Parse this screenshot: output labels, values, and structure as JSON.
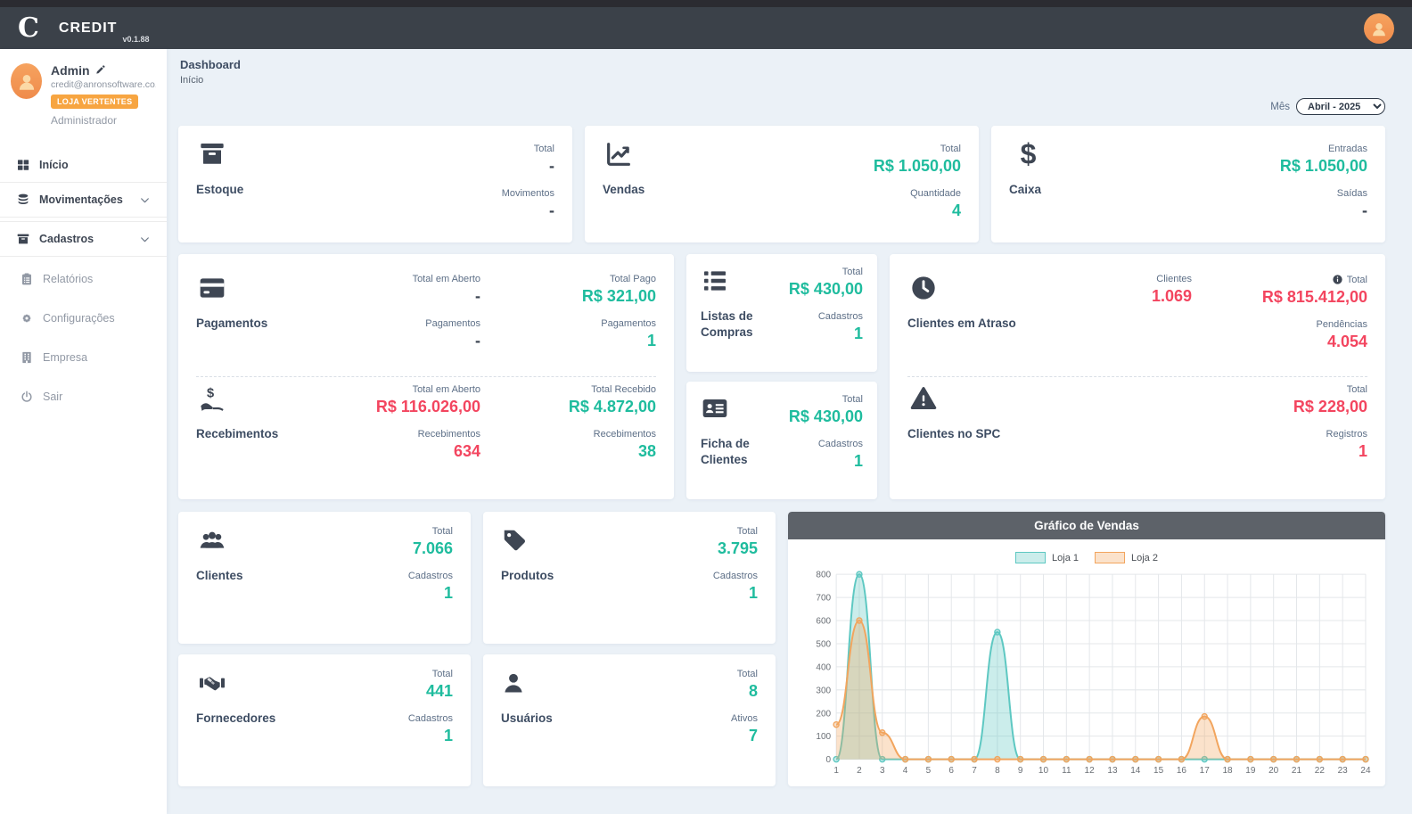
{
  "colors": {
    "accent_teal": "#1fbc9e",
    "accent_red": "#f3455f",
    "accent_orange": "#f7a541",
    "navbar": "#3b4149",
    "chart_header": "#5d6269"
  },
  "navbar": {
    "logo_letter": "C",
    "app_name": "CREDIT",
    "version": "v0.1.88"
  },
  "sidebar": {
    "user": {
      "name": "Admin",
      "email": "credit@anronsoftware.co...",
      "badge": "LOJA VERTENTES",
      "role": "Administrador"
    },
    "items": [
      {
        "label": "Início",
        "icon": "grid-icon"
      },
      {
        "label": "Movimentações",
        "icon": "database-icon",
        "expandable": true
      },
      {
        "label": "Cadastros",
        "icon": "archive-icon",
        "expandable": true
      },
      {
        "label": "Relatórios",
        "icon": "clipboard-icon"
      },
      {
        "label": "Configurações",
        "icon": "gear-icon"
      },
      {
        "label": "Empresa",
        "icon": "building-icon"
      },
      {
        "label": "Sair",
        "icon": "power-icon"
      }
    ]
  },
  "header": {
    "title": "Dashboard",
    "breadcrumb": "Início",
    "month_label": "Mês",
    "month_value": "Abril - 2025"
  },
  "summary_cards": [
    {
      "title": "Estoque",
      "icon": "box-icon",
      "stats": [
        {
          "label": "Total",
          "value": "-",
          "tone": "dark"
        },
        {
          "label": "Movimentos",
          "value": "-",
          "tone": "dark"
        }
      ]
    },
    {
      "title": "Vendas",
      "icon": "chart-line-icon",
      "stats": [
        {
          "label": "Total",
          "value": "R$ 1.050,00",
          "tone": "teal"
        },
        {
          "label": "Quantidade",
          "value": "4",
          "tone": "teal"
        }
      ]
    },
    {
      "title": "Caixa",
      "icon": "dollar-icon",
      "stats": [
        {
          "label": "Entradas",
          "value": "R$ 1.050,00",
          "tone": "teal"
        },
        {
          "label": "Saídas",
          "value": "-",
          "tone": "dark"
        }
      ]
    }
  ],
  "finance_card": {
    "pagamentos": {
      "title": "Pagamentos",
      "icon": "credit-card-icon",
      "open": {
        "label": "Total em Aberto",
        "value": "-",
        "tone": "dark"
      },
      "open_count": {
        "label": "Pagamentos",
        "value": "-",
        "tone": "dark"
      },
      "paid": {
        "label": "Total Pago",
        "value": "R$ 321,00",
        "tone": "teal"
      },
      "paid_count": {
        "label": "Pagamentos",
        "value": "1",
        "tone": "teal"
      }
    },
    "recebimentos": {
      "title": "Recebimentos",
      "icon": "hand-dollar-icon",
      "open": {
        "label": "Total em Aberto",
        "value": "R$ 116.026,00",
        "tone": "red"
      },
      "open_count": {
        "label": "Recebimentos",
        "value": "634",
        "tone": "red"
      },
      "received": {
        "label": "Total Recebido",
        "value": "R$ 4.872,00",
        "tone": "teal"
      },
      "received_count": {
        "label": "Recebimentos",
        "value": "38",
        "tone": "teal"
      }
    }
  },
  "mini_cards": [
    {
      "title": "Listas de Compras",
      "icon": "list-icon",
      "stats": [
        {
          "label": "Total",
          "value": "R$ 430,00",
          "tone": "teal"
        },
        {
          "label": "Cadastros",
          "value": "1",
          "tone": "teal"
        }
      ]
    },
    {
      "title": "Ficha de Clientes",
      "icon": "id-card-icon",
      "stats": [
        {
          "label": "Total",
          "value": "R$ 430,00",
          "tone": "teal"
        },
        {
          "label": "Cadastros",
          "value": "1",
          "tone": "teal"
        }
      ]
    }
  ],
  "alert_card": {
    "atraso": {
      "title": "Clientes em Atraso",
      "icon": "clock-icon",
      "clientes": {
        "label": "Clientes",
        "value": "1.069",
        "tone": "red"
      },
      "total": {
        "label": "Total",
        "value": "R$ 815.412,00",
        "tone": "red",
        "info_icon": true
      },
      "pendencias": {
        "label": "Pendências",
        "value": "4.054",
        "tone": "red"
      }
    },
    "spc": {
      "title": "Clientes no SPC",
      "icon": "warning-icon",
      "total": {
        "label": "Total",
        "value": "R$ 228,00",
        "tone": "red"
      },
      "registros": {
        "label": "Registros",
        "value": "1",
        "tone": "red"
      }
    }
  },
  "count_cards": [
    {
      "title": "Clientes",
      "icon": "users-icon",
      "stats": [
        {
          "label": "Total",
          "value": "7.066",
          "tone": "teal"
        },
        {
          "label": "Cadastros",
          "value": "1",
          "tone": "teal"
        }
      ]
    },
    {
      "title": "Produtos",
      "icon": "tag-icon",
      "stats": [
        {
          "label": "Total",
          "value": "3.795",
          "tone": "teal"
        },
        {
          "label": "Cadastros",
          "value": "1",
          "tone": "teal"
        }
      ]
    },
    {
      "title": "Fornecedores",
      "icon": "handshake-icon",
      "stats": [
        {
          "label": "Total",
          "value": "441",
          "tone": "teal"
        },
        {
          "label": "Cadastros",
          "value": "1",
          "tone": "teal"
        }
      ]
    },
    {
      "title": "Usuários",
      "icon": "user-icon",
      "stats": [
        {
          "label": "Total",
          "value": "8",
          "tone": "teal"
        },
        {
          "label": "Ativos",
          "value": "7",
          "tone": "teal"
        }
      ]
    }
  ],
  "chart_data": {
    "type": "area",
    "title": "Gráfico de Vendas",
    "x": [
      1,
      2,
      3,
      4,
      5,
      6,
      7,
      8,
      9,
      10,
      11,
      12,
      13,
      14,
      15,
      16,
      17,
      18,
      19,
      20,
      21,
      22,
      23,
      24
    ],
    "series": [
      {
        "name": "Loja 1",
        "color": "#5ec8c2",
        "fill": "rgba(94,200,194,0.32)",
        "values": [
          0,
          800,
          0,
          0,
          0,
          0,
          0,
          550,
          0,
          0,
          0,
          0,
          0,
          0,
          0,
          0,
          0,
          0,
          0,
          0,
          0,
          0,
          0,
          0
        ]
      },
      {
        "name": "Loja 2",
        "color": "#f2a55e",
        "fill": "rgba(242,165,94,0.32)",
        "values": [
          150,
          600,
          115,
          0,
          0,
          0,
          0,
          0,
          0,
          0,
          0,
          0,
          0,
          0,
          0,
          0,
          185,
          0,
          0,
          0,
          0,
          0,
          0,
          0
        ]
      }
    ],
    "ylim": [
      0,
      800
    ],
    "ytick_step": 100,
    "grid": true,
    "legend_position": "top",
    "xlabel": "",
    "ylabel": ""
  }
}
